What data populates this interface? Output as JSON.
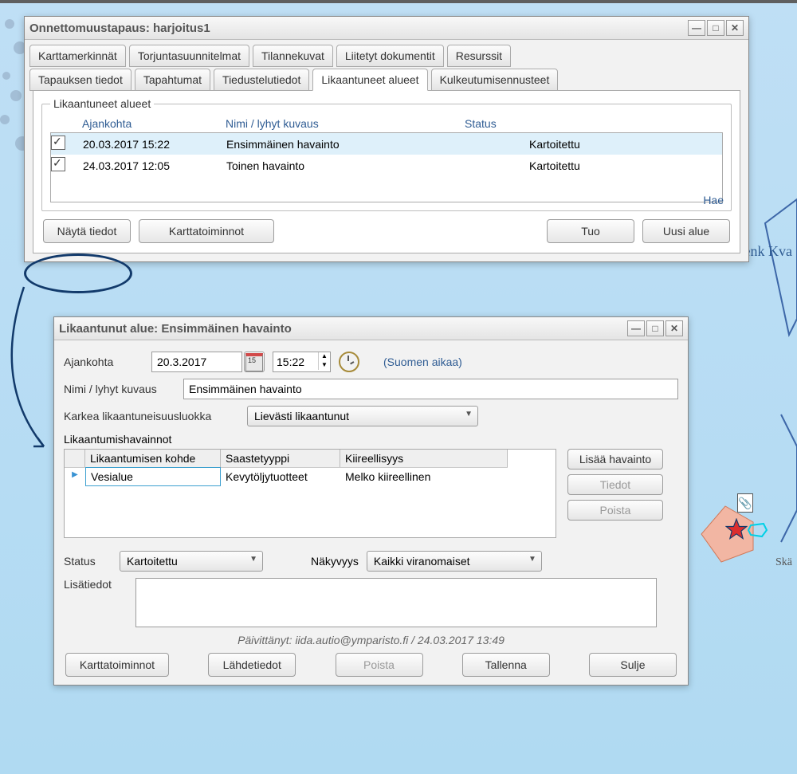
{
  "mainWindow": {
    "titlePrefix": "Onnettomuustapaus:",
    "titleName": "harjoitus1",
    "tabsRow1": [
      "Karttamerkinnät",
      "Torjuntasuunnitelmat",
      "Tilannekuvat",
      "Liitetyt dokumentit",
      "Resurssit"
    ],
    "tabsRow2": [
      "Tapauksen tiedot",
      "Tapahtumat",
      "Tiedustelutiedot",
      "Likaantuneet alueet",
      "Kulkeutumisennusteet"
    ],
    "groupLegend": "Likaantuneet alueet",
    "tableHeaders": {
      "time": "Ajankohta",
      "name": "Nimi / lyhyt kuvaus",
      "status": "Status"
    },
    "rows": [
      {
        "checked": true,
        "time": "20.03.2017 15:22",
        "name": "Ensimmäinen havainto",
        "status": "Kartoitettu",
        "selected": true
      },
      {
        "checked": true,
        "time": "24.03.2017 12:05",
        "name": "Toinen havainto",
        "status": "Kartoitettu",
        "selected": false
      }
    ],
    "haeLabel": "Hae",
    "btnShow": "Näytä tiedot",
    "btnMap": "Karttatoiminnot",
    "btnImport": "Tuo",
    "btnNew": "Uusi alue"
  },
  "detailWindow": {
    "titlePrefix": "Likaantunut alue:",
    "titleName": "Ensimmäinen havainto",
    "labels": {
      "time": "Ajankohta",
      "name": "Nimi / lyhyt kuvaus",
      "pollutionClass": "Karkea likaantuneisuusluokka",
      "observations": "Likaantumishavainnot",
      "status": "Status",
      "visibility": "Näkyvyys",
      "extra": "Lisätiedot"
    },
    "date": "20.3.2017",
    "time": "15:22",
    "tzNote": "(Suomen aikaa)",
    "nameValue": "Ensimmäinen havainto",
    "pollutionValue": "Lievästi likaantunut",
    "obsHeaders": {
      "target": "Likaantumisen kohde",
      "type": "Saastetyyppi",
      "urgency": "Kiireellisyys"
    },
    "obsRow": {
      "target": "Vesialue",
      "type": "Kevytöljytuotteet",
      "urgency": "Melko kiireellinen"
    },
    "btnAddObs": "Lisää havainto",
    "btnObsDetails": "Tiedot",
    "btnObsDelete": "Poista",
    "statusValue": "Kartoitettu",
    "visibilityValue": "Kaikki viranomaiset",
    "extraValue": "",
    "updatedPrefix": "Päivittänyt:",
    "updatedValue": "iida.autio@ymparisto.fi / 24.03.2017 13:49",
    "btnMap": "Karttatoiminnot",
    "btnSource": "Lähdetiedot",
    "btnDelete": "Poista",
    "btnSave": "Tallenna",
    "btnClose": "Sulje"
  },
  "mapLabels": {
    "kvark": "enk\nKva",
    "ska": "Skä"
  }
}
